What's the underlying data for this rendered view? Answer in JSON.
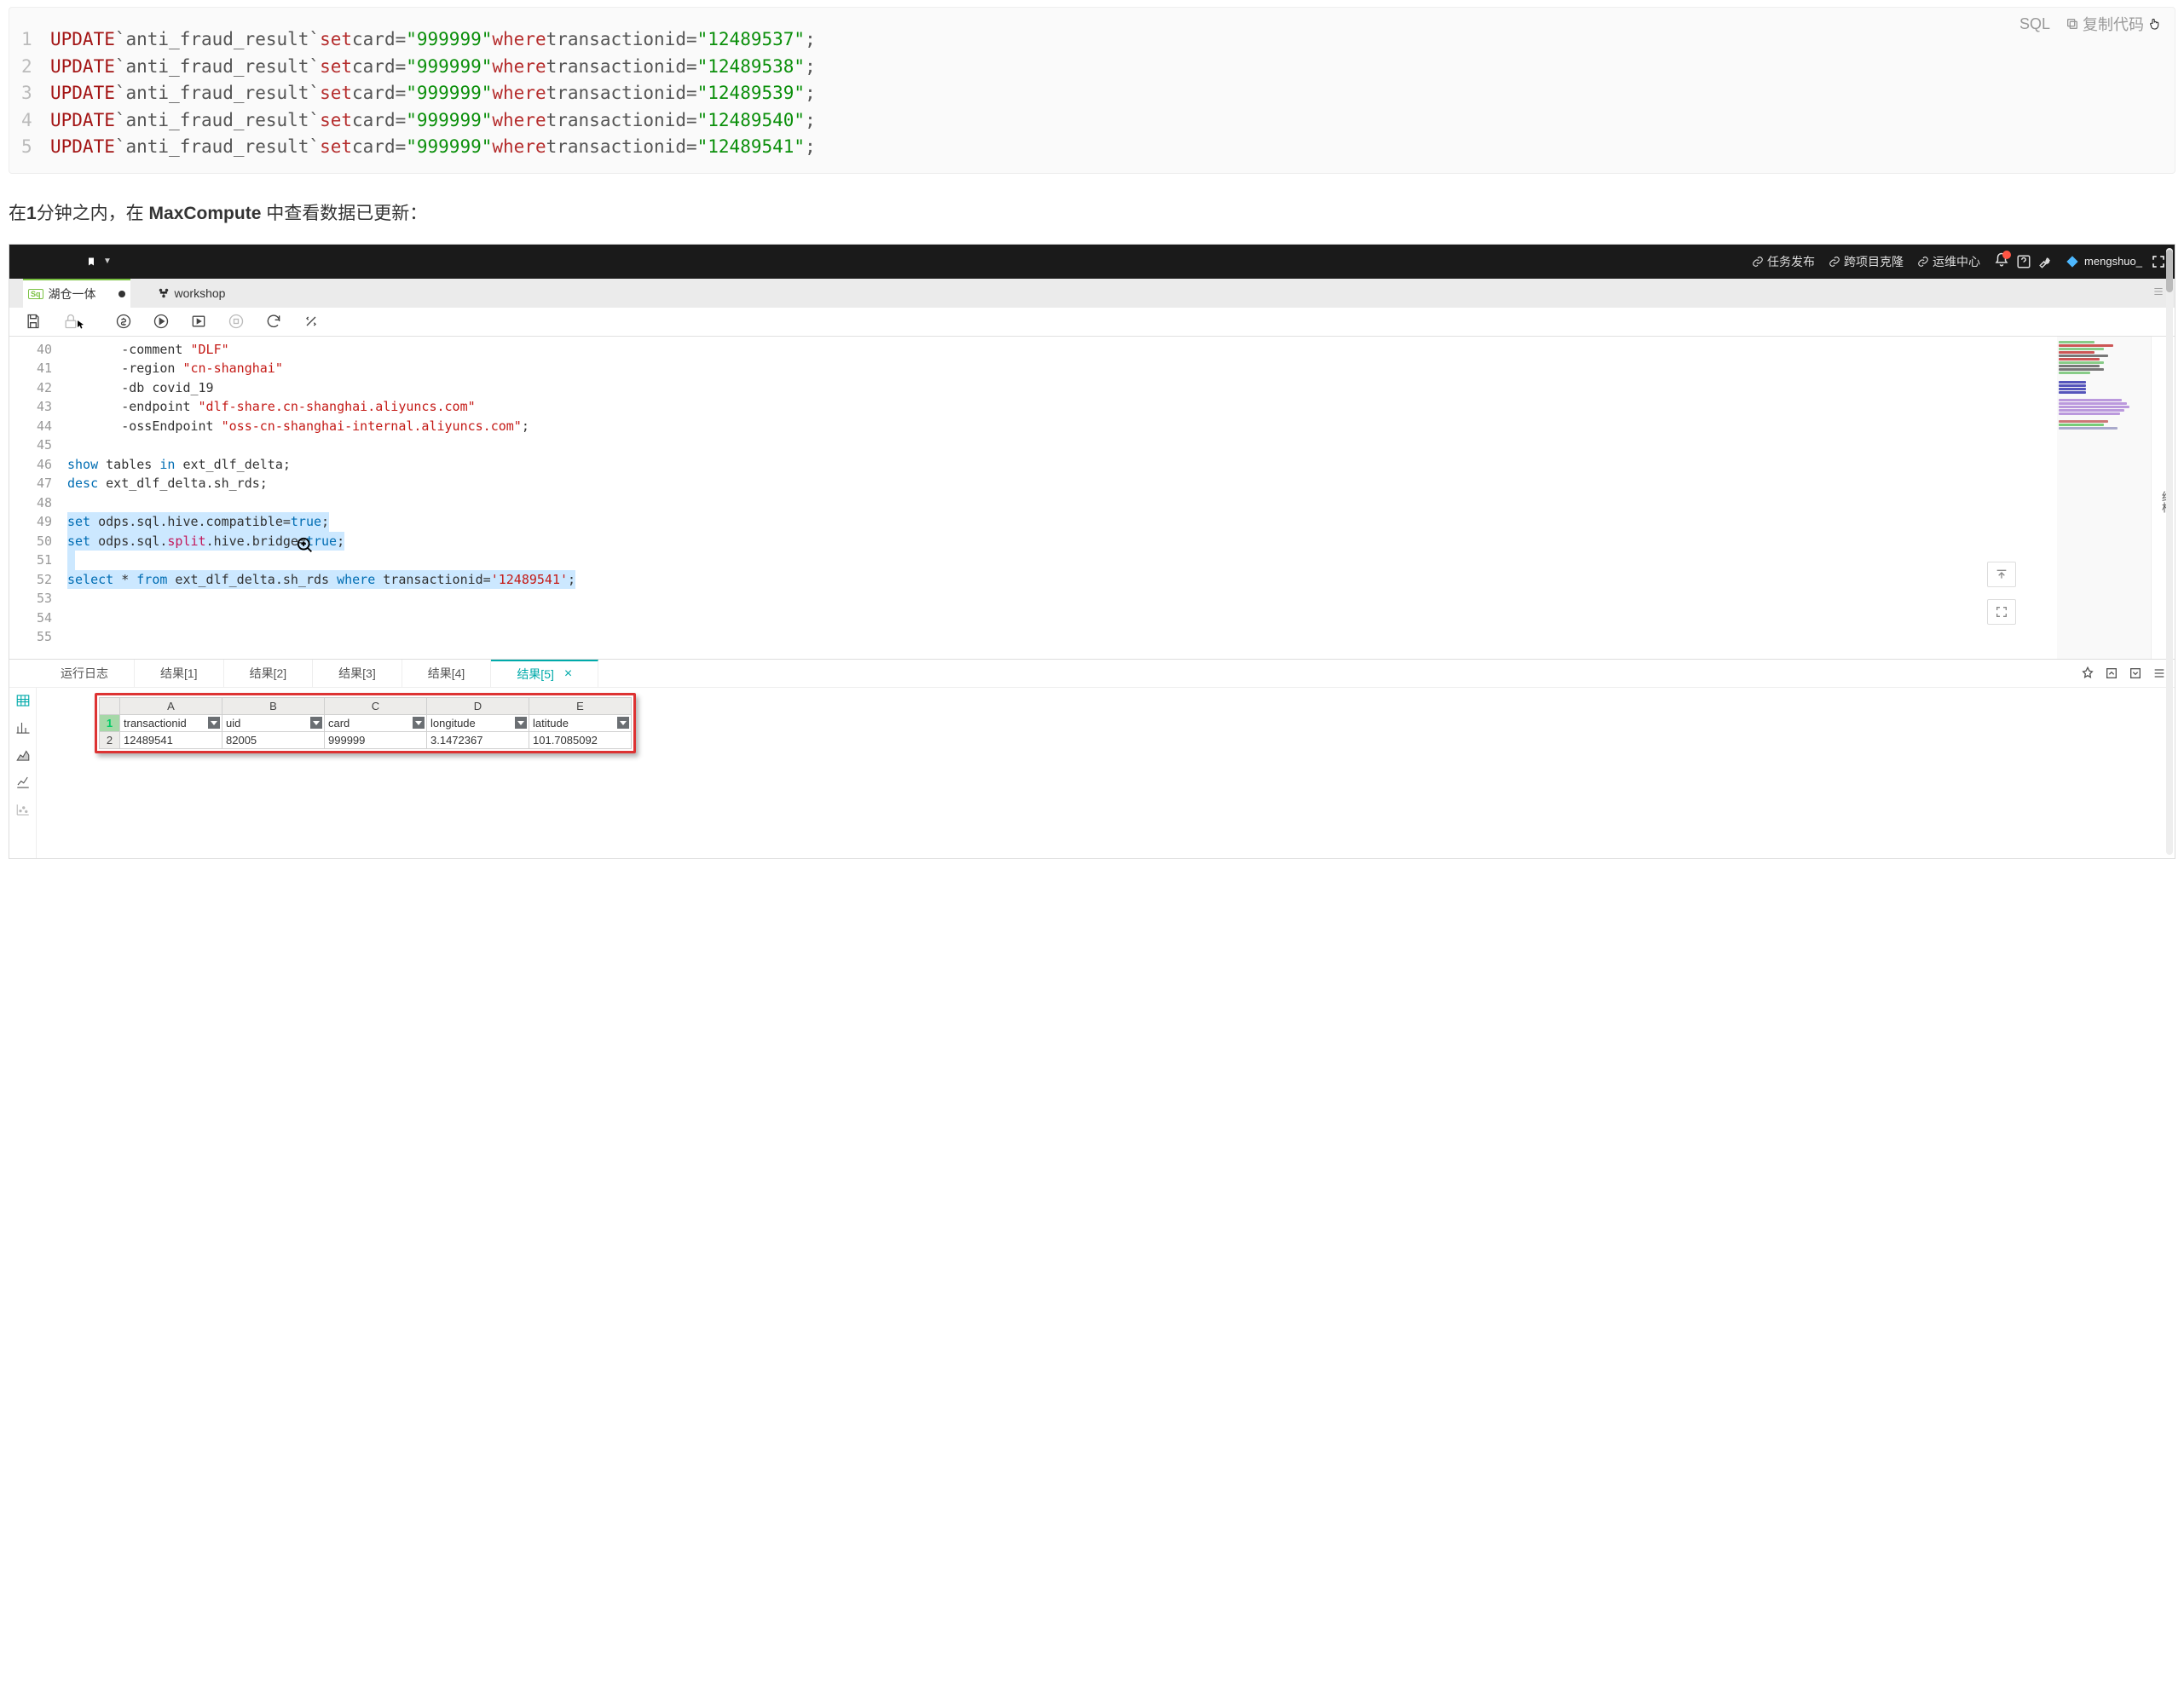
{
  "code_header": {
    "lang": "SQL",
    "copy": "复制代码"
  },
  "code_lines": [
    {
      "n": "1",
      "table": "`anti_fraud_result`",
      "card": "\"999999\"",
      "txid": "\"12489537\""
    },
    {
      "n": "2",
      "table": "`anti_fraud_result`",
      "card": "\"999999\"",
      "txid": "\"12489538\""
    },
    {
      "n": "3",
      "table": "`anti_fraud_result`",
      "card": "\"999999\"",
      "txid": "\"12489539\""
    },
    {
      "n": "4",
      "table": "`anti_fraud_result`",
      "card": "\"999999\"",
      "txid": "\"12489540\""
    },
    {
      "n": "5",
      "table": "`anti_fraud_result`",
      "card": "\"999999\"",
      "txid": "\"12489541\""
    }
  ],
  "kw": {
    "update": "UPDATE",
    "set": "set",
    "card": "card=",
    "where": "where",
    "txid": "transactionid="
  },
  "caption": {
    "p1": "在",
    "b1": "1",
    "p2": "分钟之内，在 ",
    "b2": "MaxCompute",
    "p3": " 中查看数据已更新："
  },
  "topnav": {
    "publish": "任务发布",
    "clone": "跨项目克隆",
    "ops": "运维中心",
    "user": "mengshuo_"
  },
  "filetabs": {
    "sq": "Sq",
    "t1": "湖仓一体",
    "t2": "workshop"
  },
  "editor": {
    "l40": {
      "n": "40",
      "a": "-comment ",
      "b": "\"DLF\""
    },
    "l41": {
      "n": "41",
      "a": "-region ",
      "b": "\"cn-shanghai\""
    },
    "l42": {
      "n": "42",
      "a": "-db covid_19"
    },
    "l43": {
      "n": "43",
      "a": "-endpoint ",
      "b": "\"dlf-share.cn-shanghai.aliyuncs.com\""
    },
    "l44": {
      "n": "44",
      "a": "-ossEndpoint ",
      "b": "\"oss-cn-shanghai-internal.aliyuncs.com\"",
      "c": ";"
    },
    "l45": {
      "n": "45"
    },
    "l46": {
      "n": "46",
      "kw1": "show",
      "a": " tables ",
      "kw2": "in",
      "b": " ext_dlf_delta;"
    },
    "l47": {
      "n": "47",
      "kw1": "desc",
      "a": " ext_dlf_delta.sh_rds;"
    },
    "l48": {
      "n": "48"
    },
    "l49": {
      "n": "49",
      "kw1": "set",
      "a": " odps.sql.hive.compatible=",
      "kw2": "true",
      "b": ";"
    },
    "l50": {
      "n": "50",
      "kw1": "set",
      "a": " odps.sql.",
      "pink": "split",
      "a2": ".hive.bridge=",
      "kw2": "true",
      "b": ";"
    },
    "l51": {
      "n": "51"
    },
    "l52": {
      "n": "52",
      "kw1": "select",
      "a": " * ",
      "kw2": "from",
      "b": " ext_dlf_delta.sh_rds ",
      "kw3": "where",
      "c": " transactionid=",
      "str": "'12489541'",
      "d": ";"
    },
    "l53": {
      "n": "53"
    },
    "l54": {
      "n": "54"
    },
    "l55": {
      "n": "55"
    }
  },
  "struct": "结构",
  "restabs": {
    "log": "运行日志",
    "r1": "结果[1]",
    "r2": "结果[2]",
    "r3": "结果[3]",
    "r4": "结果[4]",
    "r5": "结果[5]"
  },
  "cols": {
    "A": "A",
    "B": "B",
    "C": "C",
    "D": "D",
    "E": "E",
    "rn1": "1",
    "rn2": "2"
  },
  "fields": {
    "transactionid": "transactionid",
    "uid": "uid",
    "card": "card",
    "longitude": "longitude",
    "latitude": "latitude"
  },
  "row": {
    "transactionid": "12489541",
    "uid": "82005",
    "card": "999999",
    "longitude": "3.1472367",
    "latitude": "101.7085092"
  }
}
